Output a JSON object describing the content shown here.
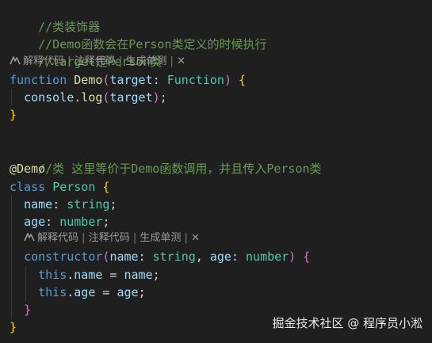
{
  "editor": {
    "colors": {
      "background": "#1f1f1f",
      "comment": "#6a9955",
      "keyword": "#569cd6",
      "function": "#dcdcaa",
      "variable": "#9cdcfe",
      "type": "#4ec9b0",
      "bracket_gold": "#ffd700",
      "bracket_orchid": "#da70d6",
      "bracket_blue": "#179fff"
    },
    "comments": {
      "c1": "//类装饰器",
      "c2": "//Demo函数会在Person类定义的时候执行",
      "c3": "//target是Person类",
      "c4": "//类 这里等价于Demo函数调用，并且传入Person类"
    },
    "codelens": {
      "icon": "sparkle-icon",
      "explain": "解释代码",
      "comment": "注释代码",
      "test": "生成单测",
      "sep": "|",
      "close": "✕"
    },
    "code": {
      "kw_function": "function",
      "fn_demo": "Demo",
      "paren_open": "(",
      "param_target": "target",
      "colon": ": ",
      "type_function": "Function",
      "paren_close": ")",
      "brace_open": "{",
      "brace_close": "}",
      "console": "console",
      "dot": ".",
      "log": "log",
      "semicolon": ";",
      "decorator": "@Demo",
      "kw_class": "class",
      "class_person": "Person",
      "prop_name": "name",
      "type_string": "string",
      "prop_age": "age",
      "type_number": "number",
      "kw_constructor": "constructor",
      "comma_space": ", ",
      "kw_this": "this",
      "equals": " = "
    }
  },
  "watermark": {
    "text": "掘金技术社区 @ 程序员小淞"
  }
}
